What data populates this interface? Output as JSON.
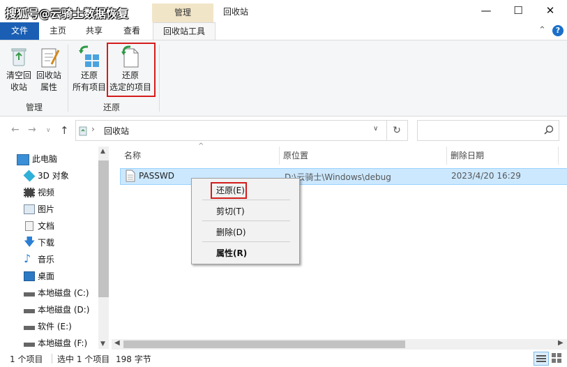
{
  "watermark": "搜狐号@云骑士数据恢复",
  "title_bar": {
    "context_tab": "管理",
    "window_title": "回收站",
    "minimize": "—",
    "maximize": "☐",
    "close": "✕"
  },
  "ribbon_tabs": {
    "file": "文件",
    "home": "主页",
    "share": "共享",
    "view": "查看",
    "recycle_tools": "回收站工具"
  },
  "ribbon": {
    "empty_bin": [
      "清空回",
      "收站"
    ],
    "bin_props": [
      "回收站",
      "属性"
    ],
    "restore_all": [
      "还原",
      "所有项目"
    ],
    "restore_selected": [
      "还原",
      "选定的项目"
    ],
    "group_manage": "管理",
    "group_restore": "还原"
  },
  "address": {
    "breadcrumb": "回收站",
    "search_placeholder": ""
  },
  "nav": {
    "items": [
      {
        "label": "此电脑",
        "icon": "pc-icon"
      },
      {
        "label": "3D 对象",
        "icon": "3d-objects-icon"
      },
      {
        "label": "视频",
        "icon": "video-icon"
      },
      {
        "label": "图片",
        "icon": "pictures-icon"
      },
      {
        "label": "文档",
        "icon": "documents-icon"
      },
      {
        "label": "下载",
        "icon": "download-icon"
      },
      {
        "label": "音乐",
        "icon": "music-icon"
      },
      {
        "label": "桌面",
        "icon": "desktop-icon"
      },
      {
        "label": "本地磁盘 (C:)",
        "icon": "drive-icon"
      },
      {
        "label": "本地磁盘 (D:)",
        "icon": "drive-icon"
      },
      {
        "label": "软件 (E:)",
        "icon": "drive-icon"
      },
      {
        "label": "本地磁盘 (F:)",
        "icon": "drive-icon"
      }
    ]
  },
  "columns": {
    "name": "名称",
    "original_location": "原位置",
    "deleted_date": "删除日期"
  },
  "files": [
    {
      "name": "PASSWD",
      "location": "D:\\云骑士\\Windows\\debug",
      "deleted": "2023/4/20 16:29"
    }
  ],
  "context_menu": {
    "restore": "还原(E)",
    "cut": "剪切(T)",
    "delete": "删除(D)",
    "properties": "属性(R)"
  },
  "status": {
    "count": "1 个项目",
    "selected": "选中 1 个项目",
    "size": "198 字节"
  },
  "colors": {
    "accent": "#1a5fb4",
    "selection": "#cce8ff",
    "highlight_box": "#d41c1c",
    "context_tab": "#f1e5c8"
  }
}
